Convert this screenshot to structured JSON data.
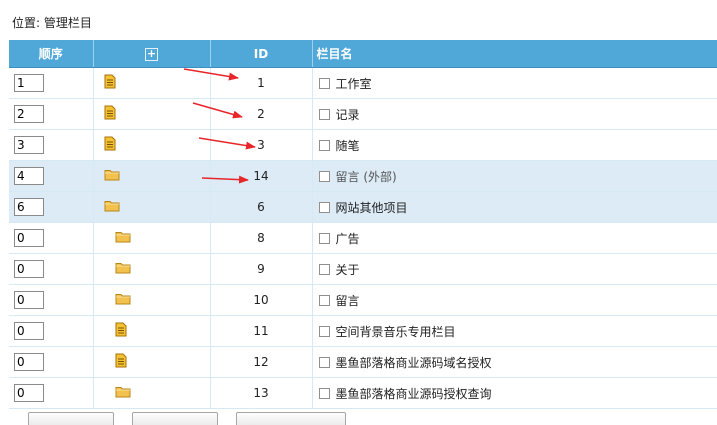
{
  "location": "位置: 管理栏目",
  "columns": {
    "order": "顺序",
    "expand": "+",
    "id": "ID",
    "name": "栏目名"
  },
  "rows": [
    {
      "order": "1",
      "icon": "document-icon",
      "id": "1",
      "name": "工作室",
      "indent": 0
    },
    {
      "order": "2",
      "icon": "document-icon",
      "id": "2",
      "name": "记录",
      "indent": 0
    },
    {
      "order": "3",
      "icon": "document-icon",
      "id": "3",
      "name": "随笔",
      "indent": 0
    },
    {
      "order": "4",
      "icon": "folder-icon",
      "id": "14",
      "name": "留言 (外部)",
      "indent": 0
    },
    {
      "order": "6",
      "icon": "folder-icon",
      "id": "6",
      "name": "网站其他项目",
      "indent": 0
    },
    {
      "order": "0",
      "icon": "folder-icon",
      "id": "8",
      "name": "广告",
      "indent": 1
    },
    {
      "order": "0",
      "icon": "folder-icon",
      "id": "9",
      "name": "关于",
      "indent": 1
    },
    {
      "order": "0",
      "icon": "folder-icon",
      "id": "10",
      "name": "留言",
      "indent": 1
    },
    {
      "order": "0",
      "icon": "document-icon",
      "id": "11",
      "name": "空间背景音乐专用栏目",
      "indent": 1
    },
    {
      "order": "0",
      "icon": "document-icon",
      "id": "12",
      "name": "墨鱼部落格商业源码域名授权",
      "indent": 1
    },
    {
      "order": "0",
      "icon": "folder-icon",
      "id": "13",
      "name": "墨鱼部落格商业源码授权查询",
      "indent": 1
    }
  ],
  "colors": {
    "header": "#4fa8d8",
    "highlight_row": "#dcebf6",
    "arrow": "#e8262a",
    "folder": "#f2c14e",
    "document": "#f5b81c"
  }
}
